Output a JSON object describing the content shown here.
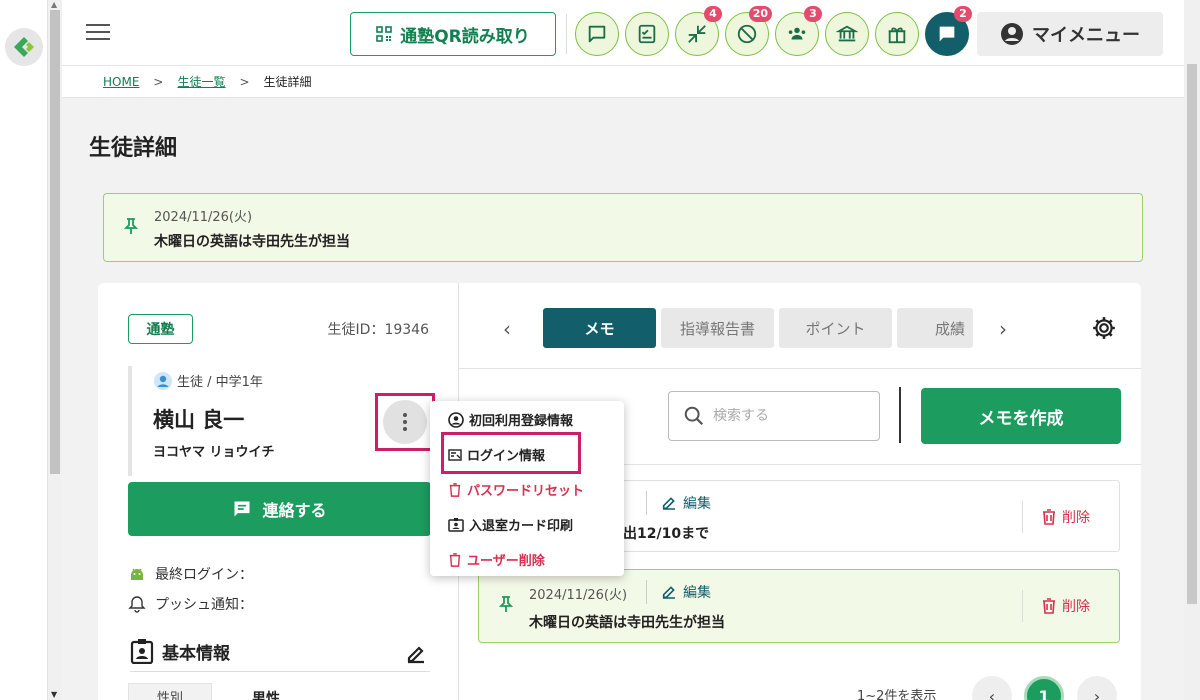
{
  "header": {
    "qr_button_label": "通塾QR読み取り",
    "icons": [
      {
        "name": "chat-bubble-icon",
        "badge": ""
      },
      {
        "name": "checklist-icon",
        "badge": ""
      },
      {
        "name": "arrows-in-icon",
        "badge": "4"
      },
      {
        "name": "no-sign-icon",
        "badge": "20"
      },
      {
        "name": "group-icon",
        "badge": "3"
      },
      {
        "name": "bank-icon",
        "badge": ""
      },
      {
        "name": "gift-icon",
        "badge": ""
      },
      {
        "name": "message-icon",
        "badge": "2"
      }
    ],
    "my_menu_label": "マイメニュー"
  },
  "breadcrumb": {
    "home": "HOME",
    "sep1": ">",
    "student_list": "生徒一覧",
    "sep2": ">",
    "current": "生徒詳細"
  },
  "page_title": "生徒詳細",
  "notice": {
    "date": "2024/11/26(火)",
    "text": "木曜日の英語は寺田先生が担当"
  },
  "profile": {
    "status_tag": "通塾",
    "student_id": "生徒ID：19346",
    "role": "生徒 / 中学1年",
    "name": "横山 良一",
    "kana": "ヨコヤマ リョウイチ",
    "contact_label": "連絡する",
    "last_login_label": "最終ログイン：",
    "push_label": "プッシュ通知：",
    "basic_info_title": "基本情報",
    "gender_label": "性別",
    "gender_value": "男性"
  },
  "popup_menu": {
    "items": [
      {
        "label": "初回利用登録情報",
        "icon": "account-circle-icon"
      },
      {
        "label": "ログイン情報",
        "icon": "login-card-icon"
      },
      {
        "label": "パスワードリセット",
        "icon": "trash-icon"
      },
      {
        "label": "入退室カード印刷",
        "icon": "id-card-icon"
      },
      {
        "label": "ユーザー削除",
        "icon": "trash-icon"
      }
    ]
  },
  "tabs": [
    {
      "label": "メモ",
      "active": true
    },
    {
      "label": "指導報告書",
      "active": false
    },
    {
      "label": "ポイント",
      "active": false
    },
    {
      "label": "成績",
      "active": false
    }
  ],
  "toolbar": {
    "search_placeholder": "検索する",
    "create_label": "メモを作成"
  },
  "memos": [
    {
      "date": ")",
      "edit_label": "編集",
      "text": "出12/10まで",
      "delete_label": "削除",
      "pinned": false
    },
    {
      "date": "2024/11/26(火)",
      "edit_label": "編集",
      "text": "木曜日の英語は寺田先生が担当",
      "delete_label": "削除",
      "pinned": true
    }
  ],
  "pager": {
    "summary": "1~2件を表示",
    "current_page": "1"
  },
  "colors": {
    "primary_green": "#1c9c5e",
    "teal": "#125e6a",
    "danger": "#d6304e",
    "highlight": "#cc1f67"
  }
}
